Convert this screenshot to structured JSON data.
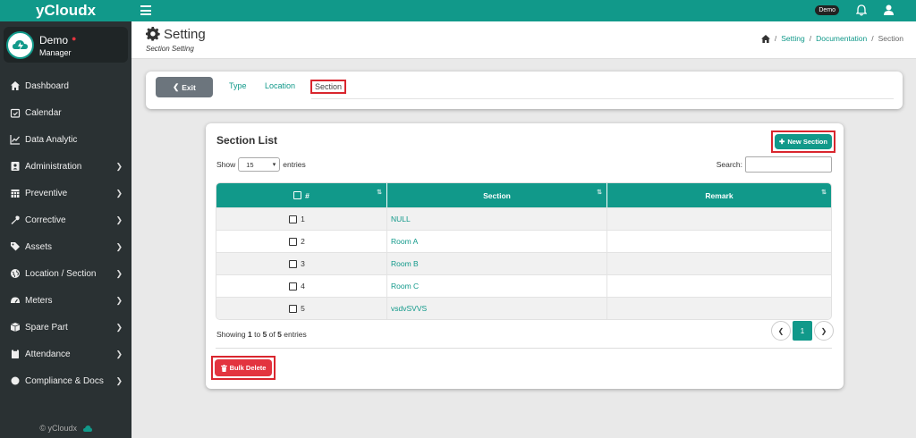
{
  "brand": "yCloudx",
  "user": {
    "name": "Demo",
    "role": "Manager",
    "status_color": "#e3343f"
  },
  "topbar": {
    "badge": "Demo",
    "accent": "#11998a"
  },
  "nav": [
    {
      "label": "Dashboard",
      "icon": "dashboard-icon",
      "has_children": false
    },
    {
      "label": "Calendar",
      "icon": "calendar-icon",
      "has_children": false
    },
    {
      "label": "Data Analytic",
      "icon": "line-chart-icon",
      "has_children": false
    },
    {
      "label": "Administration",
      "icon": "id-card-icon",
      "has_children": true
    },
    {
      "label": "Preventive",
      "icon": "calendar-grid-icon",
      "has_children": true
    },
    {
      "label": "Corrective",
      "icon": "wrench-icon",
      "has_children": true
    },
    {
      "label": "Assets",
      "icon": "tag-icon",
      "has_children": true
    },
    {
      "label": "Location / Section",
      "icon": "globe-icon",
      "has_children": true
    },
    {
      "label": "Meters",
      "icon": "gauge-icon",
      "has_children": true
    },
    {
      "label": "Spare Part",
      "icon": "box-icon",
      "has_children": true
    },
    {
      "label": "Attendance",
      "icon": "clipboard-icon",
      "has_children": true
    },
    {
      "label": "Compliance & Docs",
      "icon": "circle-icon",
      "has_children": true
    }
  ],
  "footer": "© yCloudx",
  "header": {
    "title": "Setting",
    "subtitle": "Section Setting",
    "breadcrumb": [
      "Setting",
      "Documentation",
      "Section"
    ]
  },
  "tabs": {
    "exit_label": "Exit",
    "items": [
      "Type",
      "Location",
      "Section"
    ],
    "active": "Section"
  },
  "list": {
    "title": "Section List",
    "new_button": "New Section",
    "show_label": "Show",
    "entries_value": "15",
    "entries_label": "entries",
    "search_label": "Search:",
    "search_value": "",
    "columns": [
      "#",
      "Section",
      "Remark"
    ],
    "rows": [
      {
        "num": "1",
        "section": "NULL",
        "remark": ""
      },
      {
        "num": "2",
        "section": "Room A",
        "remark": ""
      },
      {
        "num": "3",
        "section": "Room B",
        "remark": ""
      },
      {
        "num": "4",
        "section": "Room C",
        "remark": ""
      },
      {
        "num": "5",
        "section": "vsdvSVVS",
        "remark": ""
      }
    ],
    "info_prefix": "Showing",
    "info_from": "1",
    "info_to_word": "to",
    "info_to": "5",
    "info_of_word": "of",
    "info_total": "5",
    "info_suffix": "entries",
    "current_page": "1",
    "bulk_delete": "Bulk Delete"
  }
}
